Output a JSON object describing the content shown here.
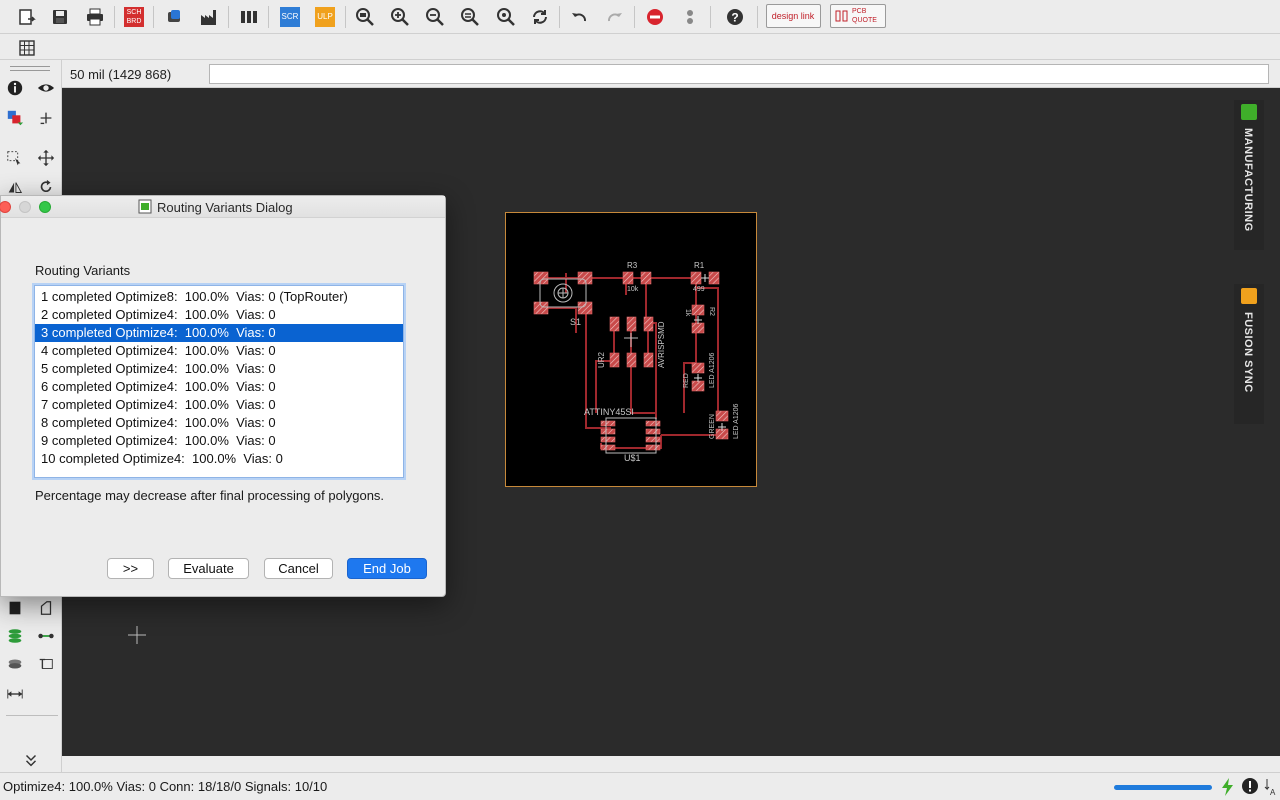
{
  "toolbar": {
    "designlink_label": "design link",
    "pcbquote_label": "PCB QUOTE",
    "sch_brd_label": "SCH BRD",
    "scr_label": "SCR",
    "ulp_label": "ULP"
  },
  "coordbar": {
    "coordinates": "50 mil (1429 868)",
    "command_value": "",
    "command_placeholder": ""
  },
  "right_panel": {
    "tabs": [
      {
        "label": "MANUFACTURING",
        "icon": "manufacturing-icon",
        "color": "#3fae2a"
      },
      {
        "label": "FUSION SYNC",
        "icon": "fusion-icon",
        "color": "#f0a11d"
      }
    ]
  },
  "board": {
    "labels": {
      "r3": "R3",
      "r3_value": "10k",
      "r1": "R1",
      "r1_value": "499",
      "s1": "S1",
      "r2": "R2",
      "r2_value": "1k",
      "avrispsmd": "AVRISPSMD",
      "ur2": "UR2",
      "led_a1206_1": "LED A1206",
      "red": "RED",
      "attiny": "ATTINY45SI",
      "u1": "U$1",
      "green": "GREEN",
      "led_a1206_2": "LED A1206"
    }
  },
  "dialog": {
    "title": "Routing Variants Dialog",
    "list_label": "Routing Variants",
    "variants": [
      "1 completed Optimize8:  100.0%  Vias: 0 (TopRouter)",
      "2 completed Optimize4:  100.0%  Vias: 0",
      "3 completed Optimize4:  100.0%  Vias: 0",
      "4 completed Optimize4:  100.0%  Vias: 0",
      "5 completed Optimize4:  100.0%  Vias: 0",
      "6 completed Optimize4:  100.0%  Vias: 0",
      "7 completed Optimize4:  100.0%  Vias: 0",
      "8 completed Optimize4:  100.0%  Vias: 0",
      "9 completed Optimize4:  100.0%  Vias: 0",
      "10 completed Optimize4:  100.0%  Vias: 0"
    ],
    "selected_index": 2,
    "note": "Percentage may decrease after final processing of polygons.",
    "buttons": {
      "more": ">>",
      "evaluate": "Evaluate",
      "cancel": "Cancel",
      "end_job": "End Job"
    }
  },
  "status": {
    "text": "Optimize4: 100.0%  Vias: 0  Conn: 18/18/0  Signals: 10/10",
    "progress_percent": 100
  },
  "colors": {
    "selection": "#0a63d1",
    "primary_button": "#1e78ef",
    "canvas": "#2b2b2b",
    "board_outline": "#c7893a",
    "pad": "#c84a4a",
    "trace": "#a0282d"
  }
}
